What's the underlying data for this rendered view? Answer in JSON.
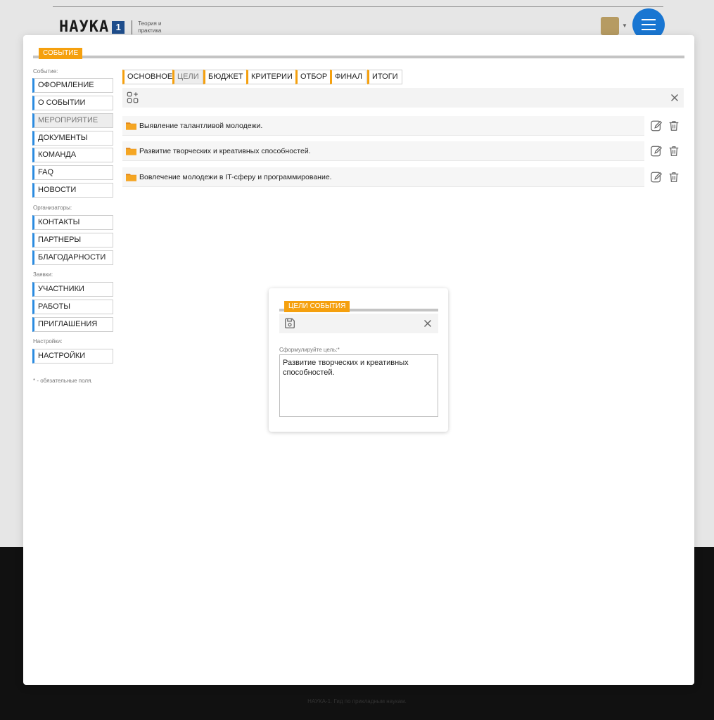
{
  "site": {
    "logo_text": "НАУКА",
    "logo_badge": "1",
    "logo_subtitle": "Теория и практика",
    "footer_text": "НАУКА-1. Гид по прикладным наукам."
  },
  "modal": {
    "header_tag": "СОБЫТИЕ",
    "sidebar": {
      "groups": [
        {
          "label": "Событие:",
          "items": [
            "ОФОРМЛЕНИЕ",
            "О СОБЫТИИ",
            "МЕРОПРИЯТИЕ",
            "ДОКУМЕНТЫ",
            "КОМАНДА",
            "FAQ",
            "НОВОСТИ"
          ]
        },
        {
          "label": "Организаторы:",
          "items": [
            "КОНТАКТЫ",
            "ПАРТНЕРЫ",
            "БЛАГОДАРНОСТИ"
          ]
        },
        {
          "label": "Заявки:",
          "items": [
            "УЧАСТНИКИ",
            "РАБОТЫ",
            "ПРИГЛАШЕНИЯ"
          ]
        },
        {
          "label": "Настройки:",
          "items": [
            "НАСТРОЙКИ"
          ]
        }
      ],
      "active_item": "МЕРОПРИЯТИЕ",
      "required_note": "* - обязательные поля."
    },
    "tabs": [
      "ОСНОВНОЕ",
      "ЦЕЛИ",
      "БЮДЖЕТ",
      "КРИТЕРИИ",
      "ОТБОР",
      "ФИНАЛ",
      "ИТОГИ"
    ],
    "active_tab": "ЦЕЛИ",
    "toolbar": {
      "add_icon": "add-grid-icon",
      "close_icon": "close-icon"
    },
    "goals": [
      "Выявление талантливой молодежи.",
      "Развитие творческих и креативных способностей.",
      "Вовлечение молодежи в IT-сферу и программирование."
    ],
    "colors": {
      "accent": "#f5a00e",
      "sidebar_accent": "#2b8be0",
      "menu_button": "#1976d2"
    }
  },
  "dialog": {
    "tag": "ЦЕЛИ СОБЫТИЯ",
    "toolbar": {
      "save_icon": "save-icon",
      "close_icon": "close-icon"
    },
    "field_label": "Сформулируйте цель:*",
    "field_value": "Развитие творческих и креативных способностей."
  }
}
